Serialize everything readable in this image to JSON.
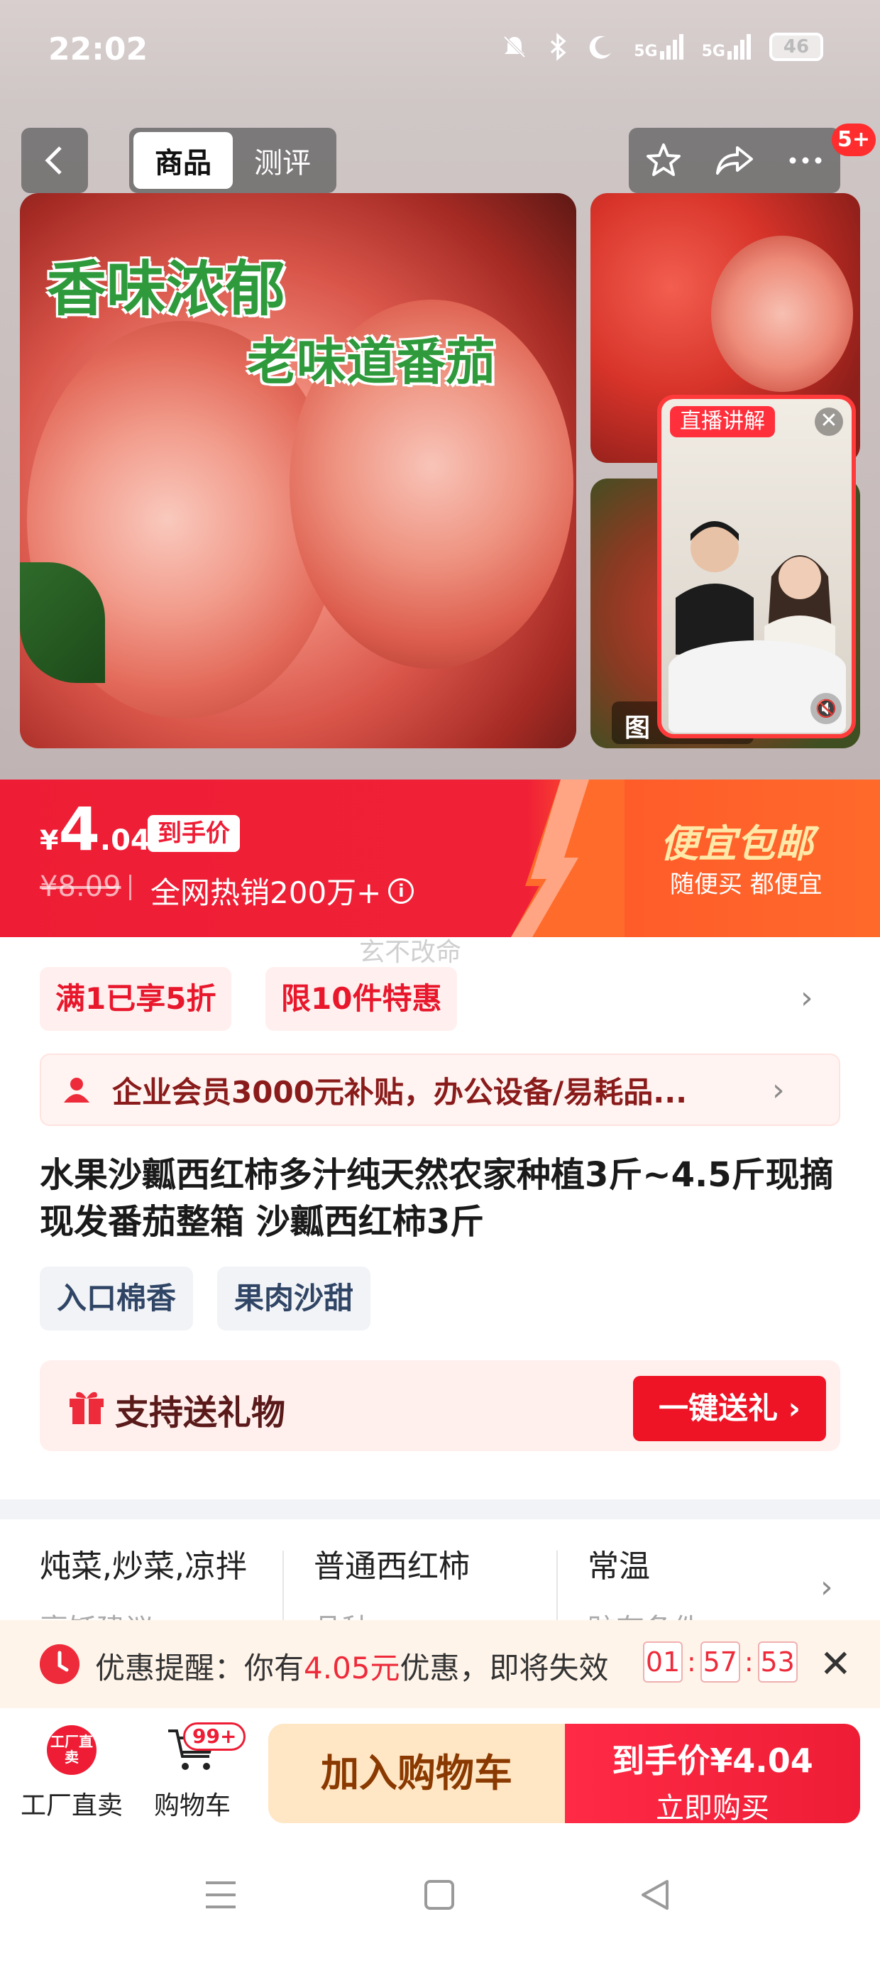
{
  "status_bar": {
    "time": "22:02",
    "network1": "5G",
    "network2": "5G",
    "battery": "46"
  },
  "nav": {
    "tabs": [
      {
        "label": "商品"
      },
      {
        "label": "测评"
      }
    ],
    "notification_badge": "5+"
  },
  "gallery": {
    "slogan_line1": "香味浓郁",
    "slogan_line2": "老味道番茄",
    "thumb_label": "图",
    "live_tag": "直播讲解",
    "live_close": "✕"
  },
  "price": {
    "currency": "¥",
    "integer": "4",
    "decimal": ".04",
    "final_price_tag": "到手价",
    "original_price": "¥8.09",
    "sales_text": "全网热销200万+",
    "promo_title": "便宜包邮",
    "promo_subtitle": "随便买 都便宜"
  },
  "watermark": "玄不改命",
  "coupons": [
    {
      "label": "满1已享5折"
    },
    {
      "label": "限10件特惠"
    }
  ],
  "vip_banner": {
    "text": "企业会员3000元补贴，办公设备/易耗品..."
  },
  "product": {
    "title": "水果沙瓤西红柿多汁纯天然农家种植3斤~4.5斤现摘现发番茄整箱 沙瓤西红柿3斤",
    "tags": [
      {
        "label": "入口棉香"
      },
      {
        "label": "果肉沙甜"
      }
    ]
  },
  "gift": {
    "text": "支持送礼物",
    "button": "一键送礼"
  },
  "attributes": [
    {
      "value": "炖菜,炒菜,凉拌",
      "key": "烹饪建议"
    },
    {
      "value": "普通西红柿",
      "key": "品种"
    },
    {
      "value": "常温",
      "key": "贮存条件"
    }
  ],
  "reminder": {
    "prefix": "优惠提醒：你有",
    "amount": "4.05元",
    "suffix": "优惠，即将失效",
    "timer": {
      "h": "01",
      "m": "57",
      "s": "53"
    }
  },
  "bottom_bar": {
    "factory": {
      "icon_text": "工厂直卖",
      "label": "工厂直卖"
    },
    "cart": {
      "label": "购物车",
      "badge": "99+"
    },
    "add_to_cart": "加入购物车",
    "buy_line1": "到手价¥4.04",
    "buy_line2": "立即购买"
  },
  "colors": {
    "brand_red": "#ee1d35",
    "promo_yellow": "#ffe9a8",
    "green_slogan": "#2e9a3c"
  }
}
